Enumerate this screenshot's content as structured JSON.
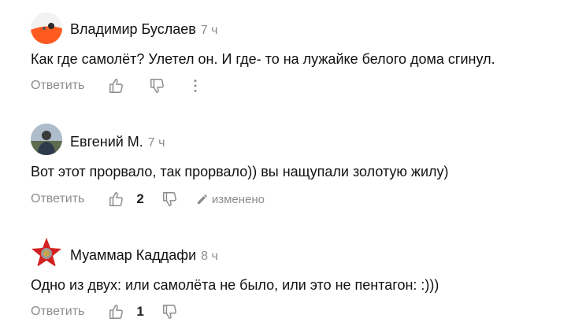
{
  "reply_label": "Ответить",
  "comments": [
    {
      "author": "Владимир Буслаев",
      "time": "7 ч",
      "text": "Как где самолёт? Улетел он. И где- то на лужайке белого дома сгинул.",
      "likes": "",
      "edited": ""
    },
    {
      "author": "Евгений М.",
      "time": "7 ч",
      "text": "Вот этот прорвало, так прорвало)) вы нащупали золотую жилу)",
      "likes": "2",
      "edited": "изменено"
    },
    {
      "author": "Муаммар Каддафи",
      "time": "8 ч",
      "text": "Одно из двух: или самолёта не было, или это не пентагон: :)))",
      "likes": "1",
      "edited": ""
    }
  ],
  "icons": {
    "like": "thumbs-up-icon",
    "dislike": "thumbs-down-icon",
    "more": "more-vertical-icon",
    "edit": "pencil-icon"
  },
  "colors": {
    "muted": "#8c8c8c",
    "text": "#111111",
    "avatar1": "#ff5a1f",
    "avatar3": "#d32020"
  }
}
